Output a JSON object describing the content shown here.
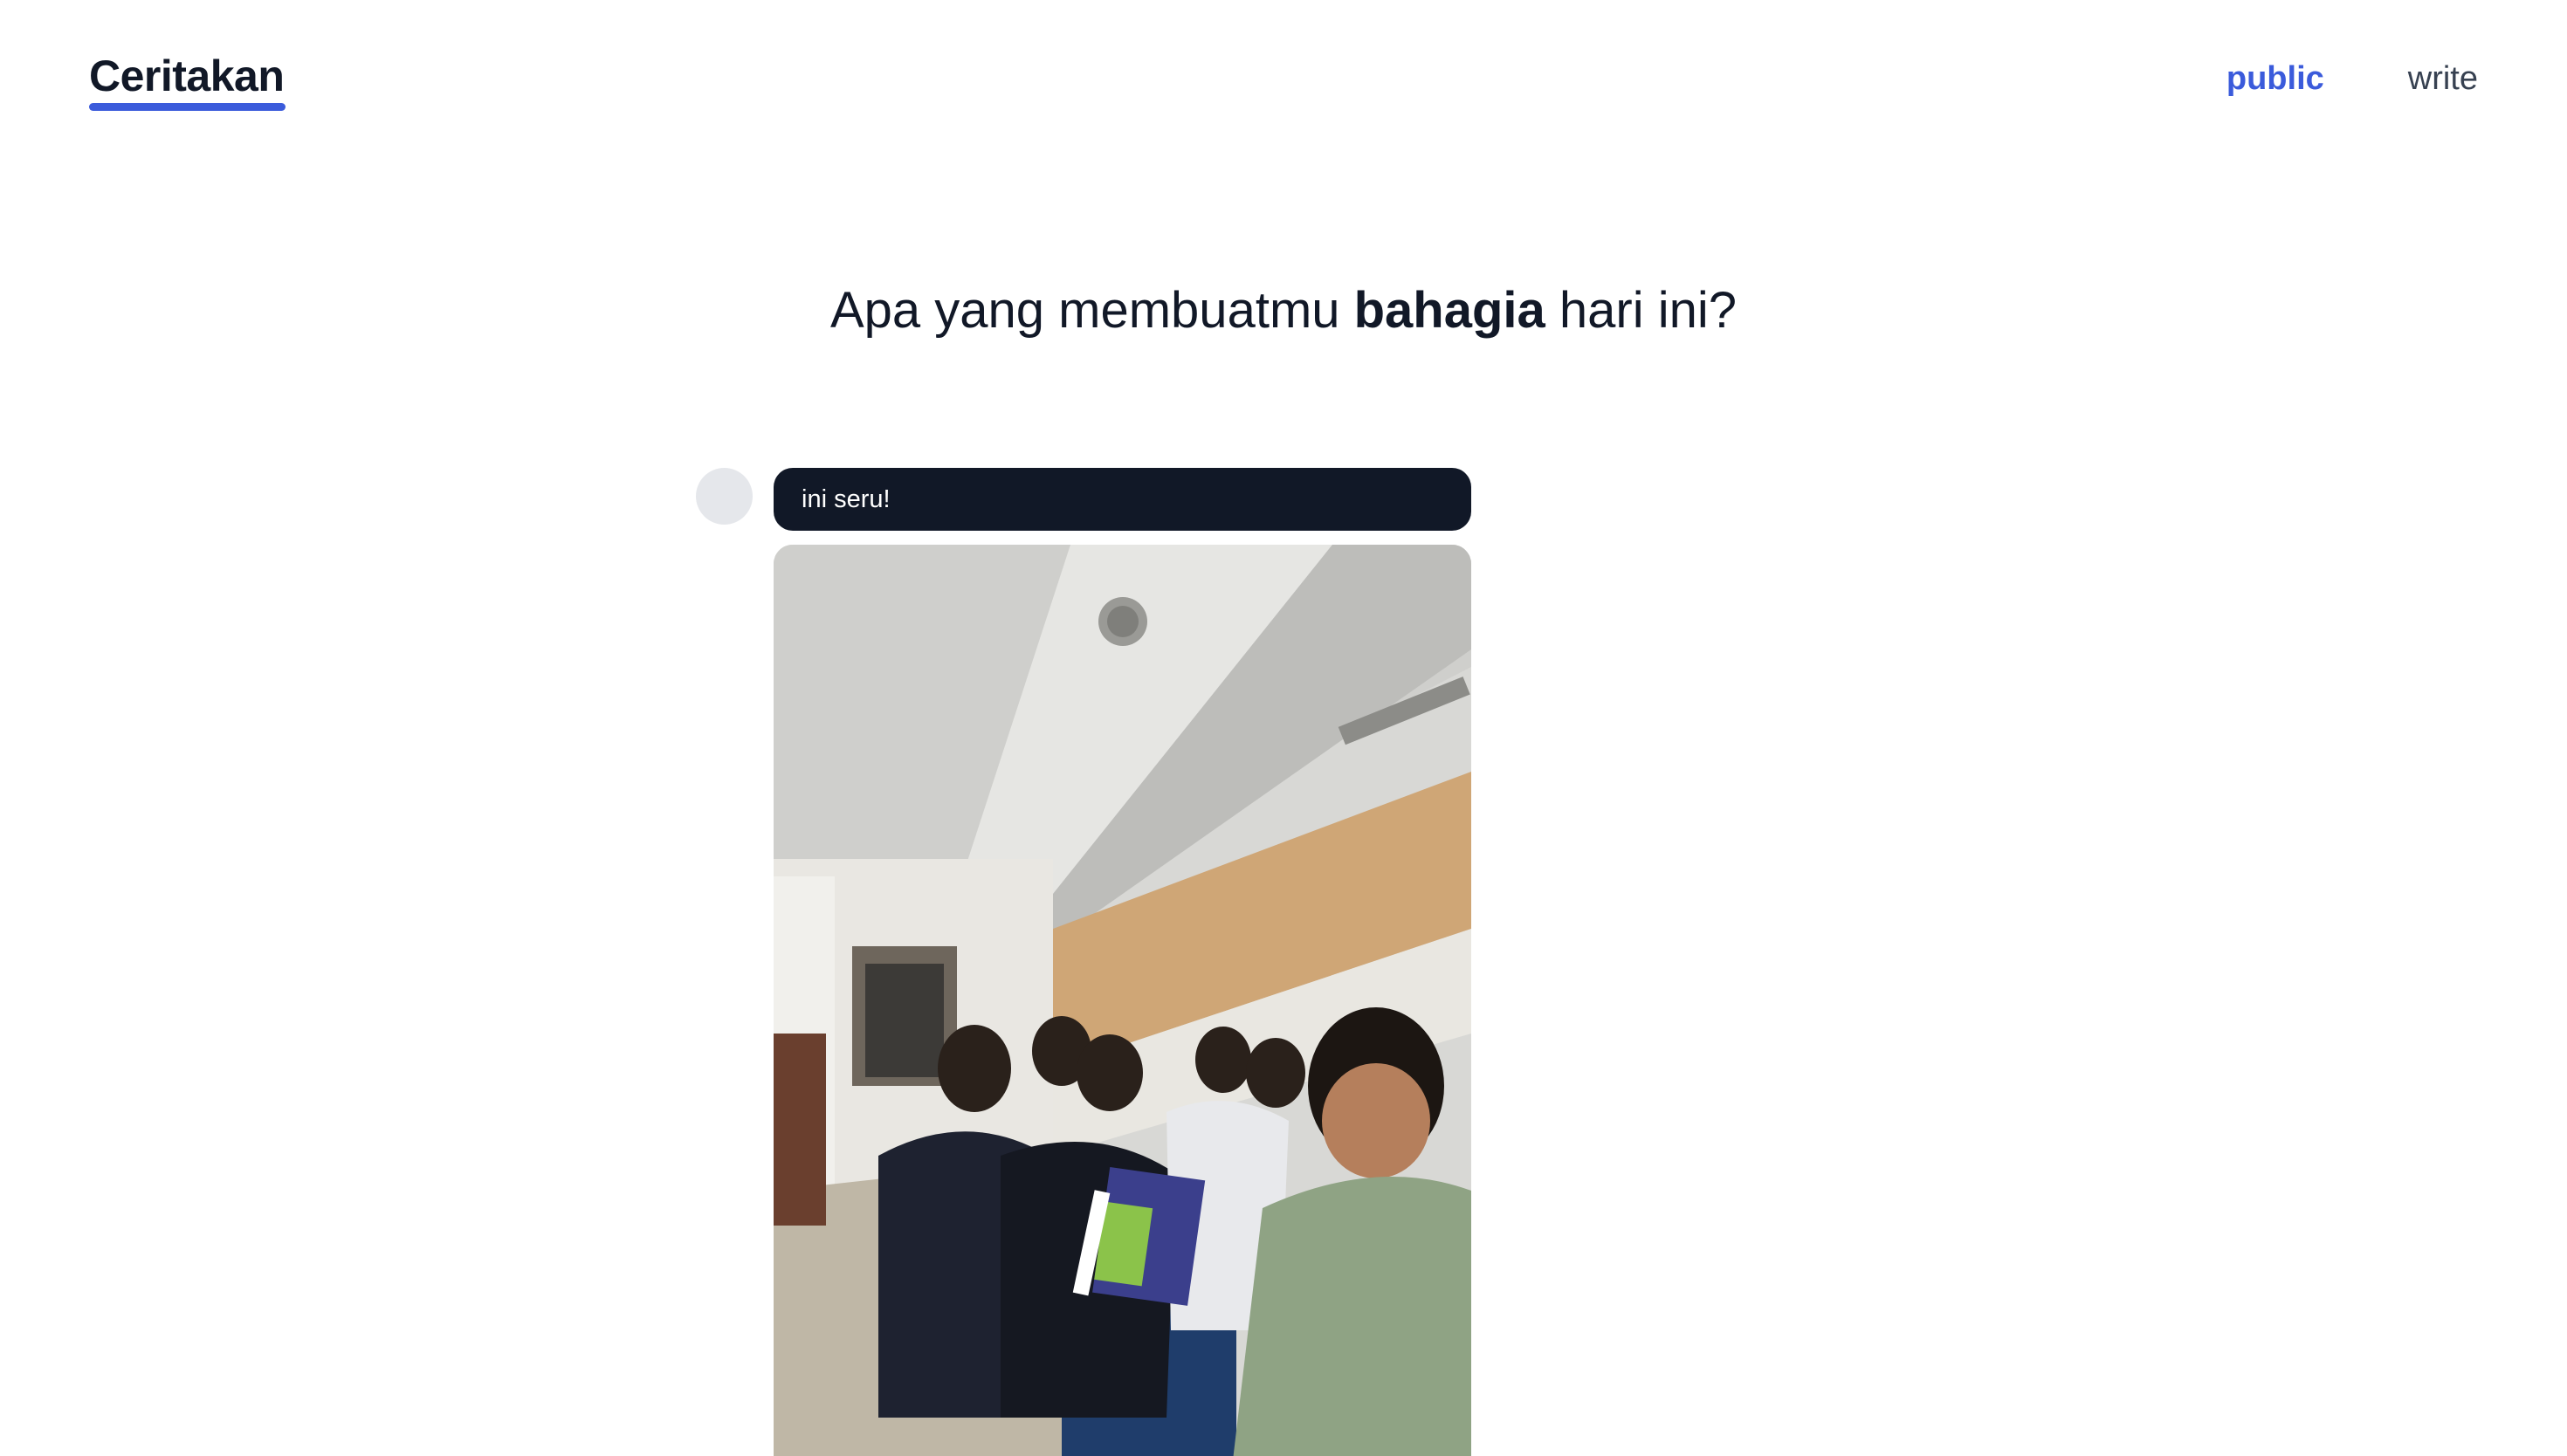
{
  "header": {
    "brand": "Ceritakan",
    "nav": [
      {
        "label": "public",
        "active": true
      },
      {
        "label": "write",
        "active": false
      }
    ],
    "accent_color": "#3b5bdb"
  },
  "prompt": {
    "before": "Apa yang membuatmu ",
    "emphasis": "bahagia",
    "after": " hari ini?"
  },
  "post": {
    "message": "ini seru!",
    "bubble_color": "#111827",
    "avatar_color": "#e5e7eb"
  }
}
